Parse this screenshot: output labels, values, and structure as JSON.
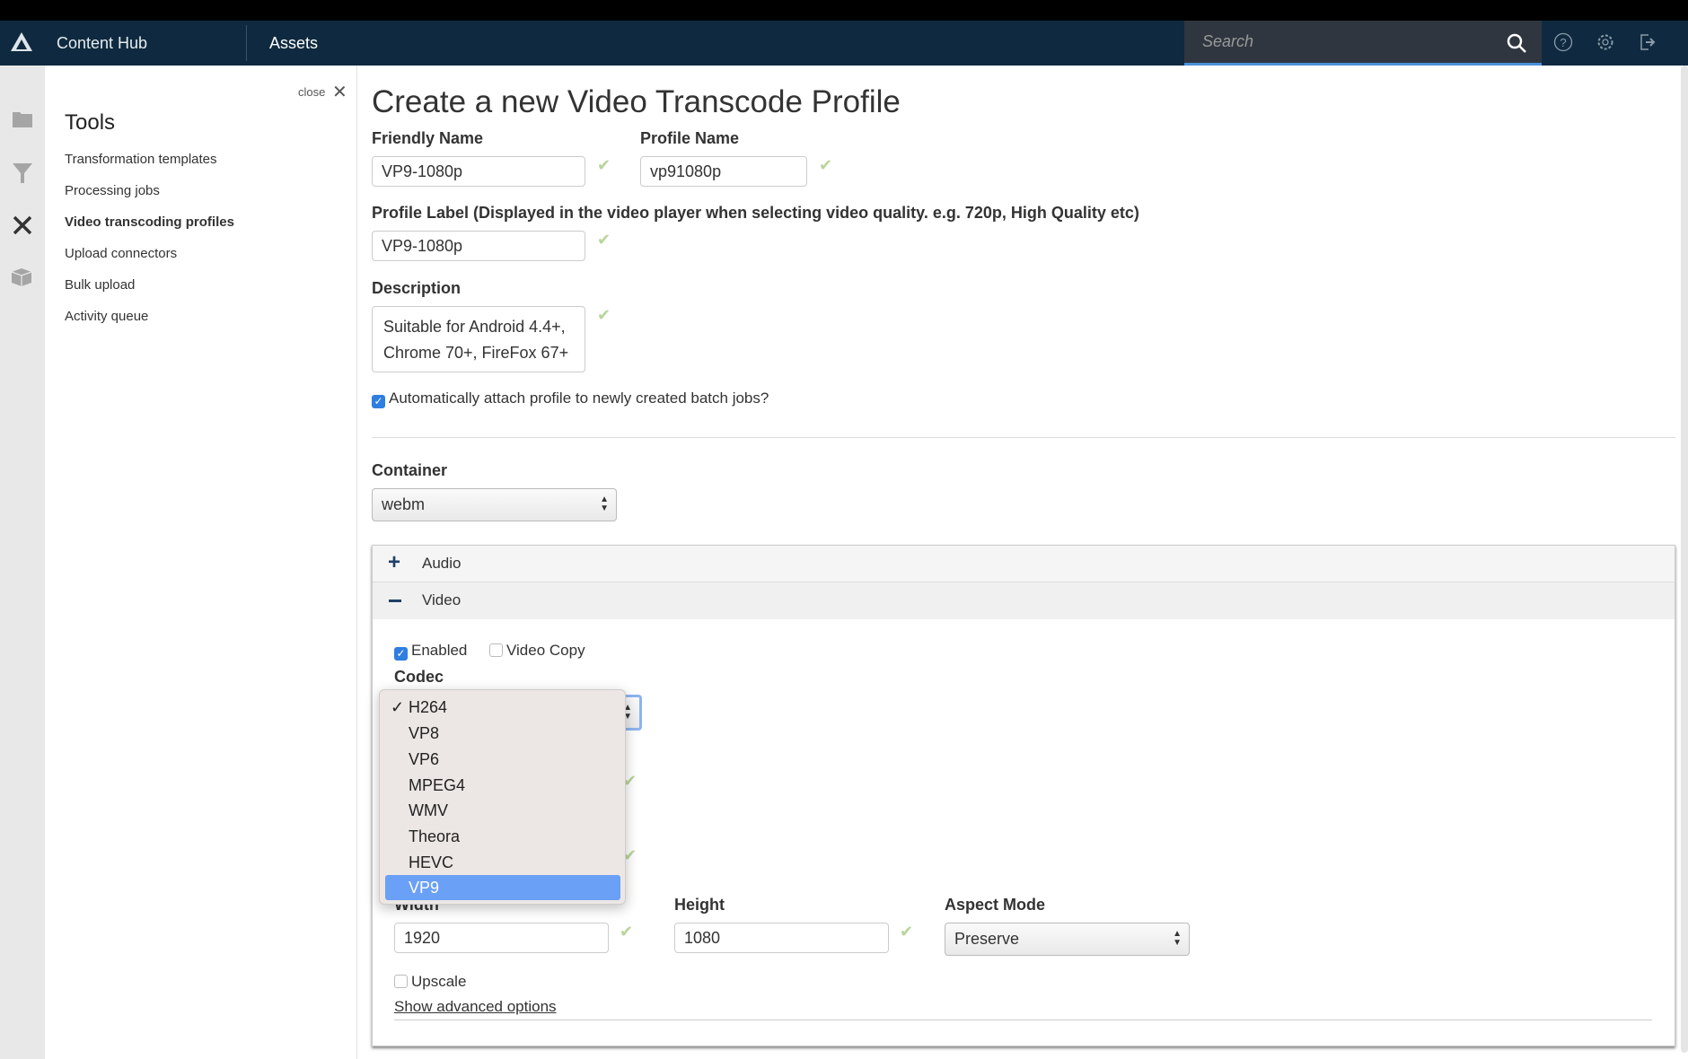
{
  "nav": {
    "app_name": "Content Hub",
    "section": "Assets",
    "search_placeholder": "Search"
  },
  "panel": {
    "close_label": "close",
    "title": "Tools",
    "items": [
      {
        "label": "Transformation templates"
      },
      {
        "label": "Processing jobs"
      },
      {
        "label": "Video transcoding profiles",
        "active": true
      },
      {
        "label": "Upload connectors"
      },
      {
        "label": "Bulk upload"
      },
      {
        "label": "Activity queue"
      }
    ]
  },
  "form": {
    "title": "Create a new Video Transcode Profile",
    "friendly_name": {
      "label": "Friendly Name",
      "value": "VP9-1080p"
    },
    "profile_name": {
      "label": "Profile Name",
      "value": "vp91080p"
    },
    "profile_label": {
      "label": "Profile Label (Displayed in the video player when selecting video quality. e.g. 720p, High Quality etc)",
      "value": "VP9-1080p"
    },
    "description": {
      "label": "Description",
      "value": "Suitable for Android 4.4+, Chrome 70+, FireFox 67+"
    },
    "auto_attach": {
      "label": "Automatically attach profile to newly created batch jobs?",
      "checked": true
    },
    "container": {
      "label": "Container",
      "value": "webm"
    },
    "audio": {
      "label": "Audio",
      "expanded": false
    },
    "video": {
      "label": "Video",
      "expanded": true,
      "enabled": {
        "label": "Enabled",
        "checked": true
      },
      "video_copy": {
        "label": "Video Copy",
        "checked": false
      },
      "codec": {
        "label": "Codec",
        "selected": "H264",
        "highlighted": "VP9",
        "options": [
          "H264",
          "VP8",
          "VP6",
          "MPEG4",
          "WMV",
          "Theora",
          "HEVC",
          "VP9"
        ]
      },
      "width": {
        "label": "Width",
        "value": "1920"
      },
      "height": {
        "label": "Height",
        "value": "1080"
      },
      "aspect_mode": {
        "label": "Aspect Mode",
        "value": "Preserve"
      },
      "upscale": {
        "label": "Upscale",
        "checked": false
      },
      "advanced_link": "Show advanced options"
    }
  },
  "colors": {
    "nav": "#0f2a40",
    "accent": "#2f7ee0",
    "highlight": "#6aa0f5",
    "valid_check": "#b9d59a"
  }
}
